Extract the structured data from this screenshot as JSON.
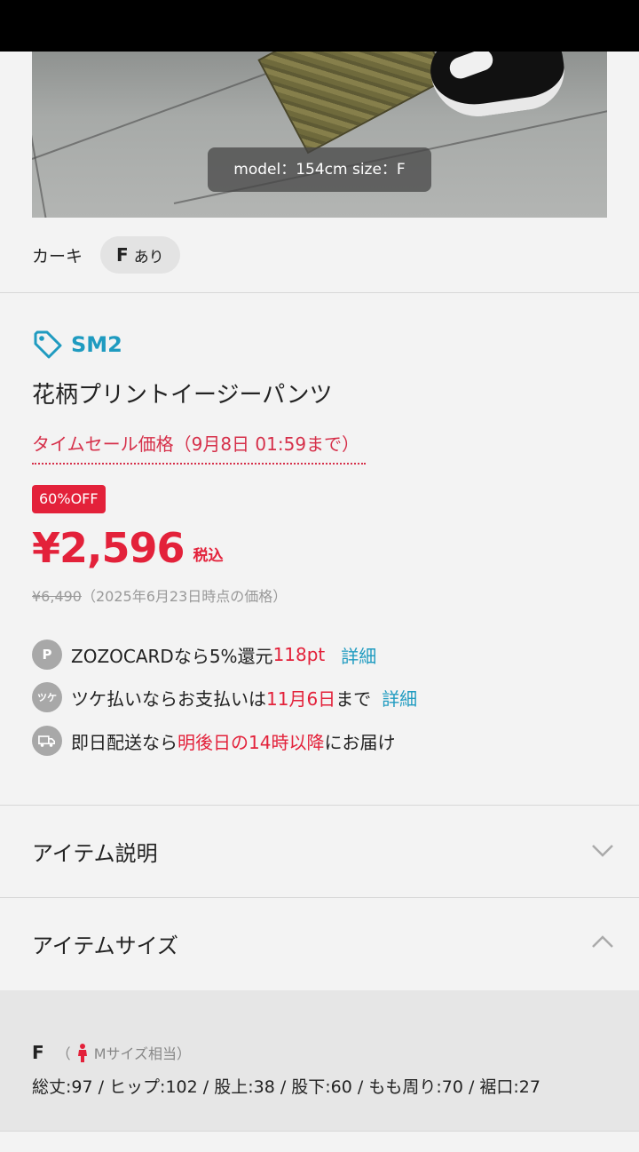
{
  "photo": {
    "caption": "model：154cm size：F"
  },
  "variant": {
    "color": "カーキ",
    "size": "F",
    "availability": "あり"
  },
  "brand": {
    "name": "SM2",
    "icon": "tag-icon"
  },
  "product": {
    "name": "花柄プリントイージーパンツ"
  },
  "sale": {
    "label": "タイムセール価格（9月8日 01:59まで）",
    "off_badge": "60%OFF"
  },
  "price": {
    "current": "¥2,596",
    "tax": "税込",
    "original": "¥6,490",
    "original_note": "（2025年6月23日時点の価格）"
  },
  "benefits": [
    {
      "icon": "points-icon",
      "icon_text": "P",
      "text_before": "ZOZOCARDなら5%還元 ",
      "highlight": "118pt",
      "text_after": "",
      "link": "詳細"
    },
    {
      "icon": "tsuke-icon",
      "icon_text": "ツケ",
      "text_before": "ツケ払いならお支払いは",
      "highlight": "11月6日",
      "text_after": "まで",
      "link": "詳細"
    },
    {
      "icon": "truck-icon",
      "icon_text": "",
      "text_before": "即日配送なら",
      "highlight": "明後日の14時以降",
      "text_after": "にお届け",
      "link": ""
    }
  ],
  "sections": {
    "description": {
      "label": "アイテム説明",
      "icon": "chevron-down-icon"
    },
    "size": {
      "label": "アイテムサイズ",
      "icon": "chevron-up-icon"
    }
  },
  "size_detail": {
    "size": "F",
    "note_open": "（",
    "note": "Mサイズ相当）",
    "measurements": "総丈:97 / ヒップ:102 / 股上:38 / 股下:60 / もも周り:70 / 裾口:27"
  },
  "colors": {
    "accent": "#1f9bc0",
    "sale": "#e3213a"
  }
}
